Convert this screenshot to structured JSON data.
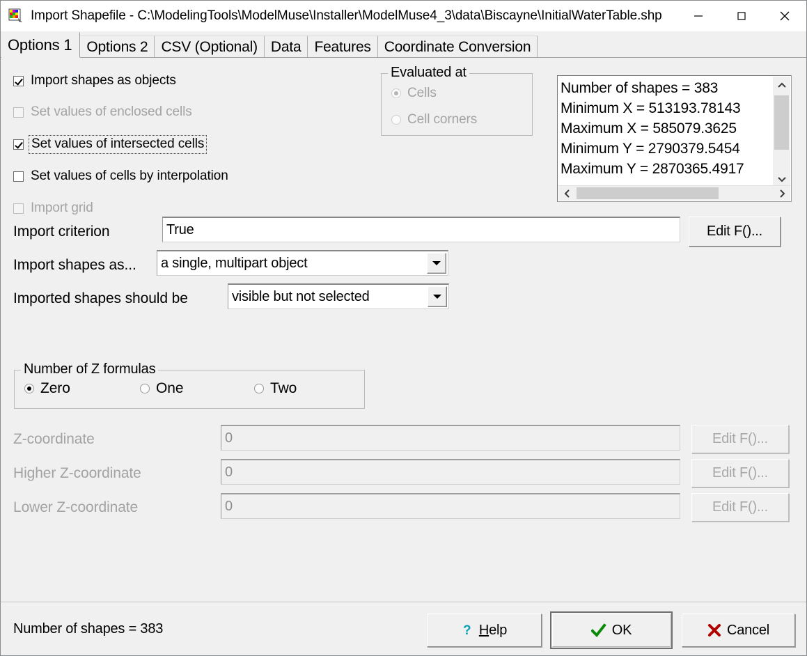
{
  "window": {
    "title": "Import Shapefile - C:\\ModelingTools\\ModelMuse\\Installer\\ModelMuse4_3\\data\\Biscayne\\InitialWaterTable.shp",
    "icon": "modelmuse-blocks-icon",
    "controls": {
      "minimize": "minimize-icon",
      "maximize": "maximize-icon",
      "close": "close-icon"
    }
  },
  "tabs": [
    {
      "label": "Options 1",
      "active": true
    },
    {
      "label": "Options 2",
      "active": false
    },
    {
      "label": "CSV (Optional)",
      "active": false
    },
    {
      "label": "Data",
      "active": false
    },
    {
      "label": "Features",
      "active": false
    },
    {
      "label": "Coordinate Conversion",
      "active": false
    }
  ],
  "checkboxes": [
    {
      "label": "Import shapes as objects",
      "checked": true,
      "enabled": true,
      "focused": false
    },
    {
      "label": "Set values of enclosed cells",
      "checked": false,
      "enabled": false,
      "focused": false
    },
    {
      "label": "Set values of intersected cells",
      "checked": true,
      "enabled": true,
      "focused": true
    },
    {
      "label": "Set values of cells by interpolation",
      "checked": false,
      "enabled": true,
      "focused": false
    },
    {
      "label": "Import grid",
      "checked": false,
      "enabled": false,
      "focused": false
    }
  ],
  "evaluated_at": {
    "title": "Evaluated at",
    "enabled": false,
    "options": [
      {
        "label": "Cells",
        "selected": true
      },
      {
        "label": "Cell corners",
        "selected": false
      }
    ]
  },
  "shape_info": {
    "lines": [
      "Number of shapes = 383",
      "Minimum X = 513193.78143",
      "Maximum X = 585079.3625",
      "Minimum Y = 2790379.5454",
      "Maximum Y = 2870365.4917"
    ]
  },
  "import_criterion": {
    "label": "Import criterion",
    "value": "True",
    "edit_button": "Edit F()..."
  },
  "import_shapes_as": {
    "label": "Import shapes as...",
    "value": "a single, multipart object"
  },
  "imported_shapes_should_be": {
    "label": "Imported shapes should be",
    "value": "visible but not selected"
  },
  "z_formulas": {
    "title": "Number of Z formulas",
    "options": [
      {
        "label": "Zero",
        "selected": true
      },
      {
        "label": "One",
        "selected": false
      },
      {
        "label": "Two",
        "selected": false
      }
    ]
  },
  "z_rows": [
    {
      "label": "Z-coordinate",
      "value": "0",
      "button": "Edit F()...",
      "enabled": false
    },
    {
      "label": "Higher Z-coordinate",
      "value": "0",
      "button": "Edit F()...",
      "enabled": false
    },
    {
      "label": "Lower Z-coordinate",
      "value": "0",
      "button": "Edit F()...",
      "enabled": false
    }
  ],
  "statusbar": {
    "text": "Number of shapes = 383",
    "buttons": {
      "help": {
        "label": "Help",
        "accel": "H",
        "icon": "question-mark-icon",
        "color": "#008b8b"
      },
      "ok": {
        "label": "OK",
        "icon": "checkmark-icon",
        "color": "#008000"
      },
      "cancel": {
        "label": "Cancel",
        "icon": "cross-icon",
        "color": "#b00000"
      }
    }
  },
  "colors": {
    "dialog_bg": "#f0f0f0",
    "field_bg": "#ffffff",
    "disabled_text": "#a3a3a3",
    "scroll_thumb": "#cdcdcd"
  }
}
